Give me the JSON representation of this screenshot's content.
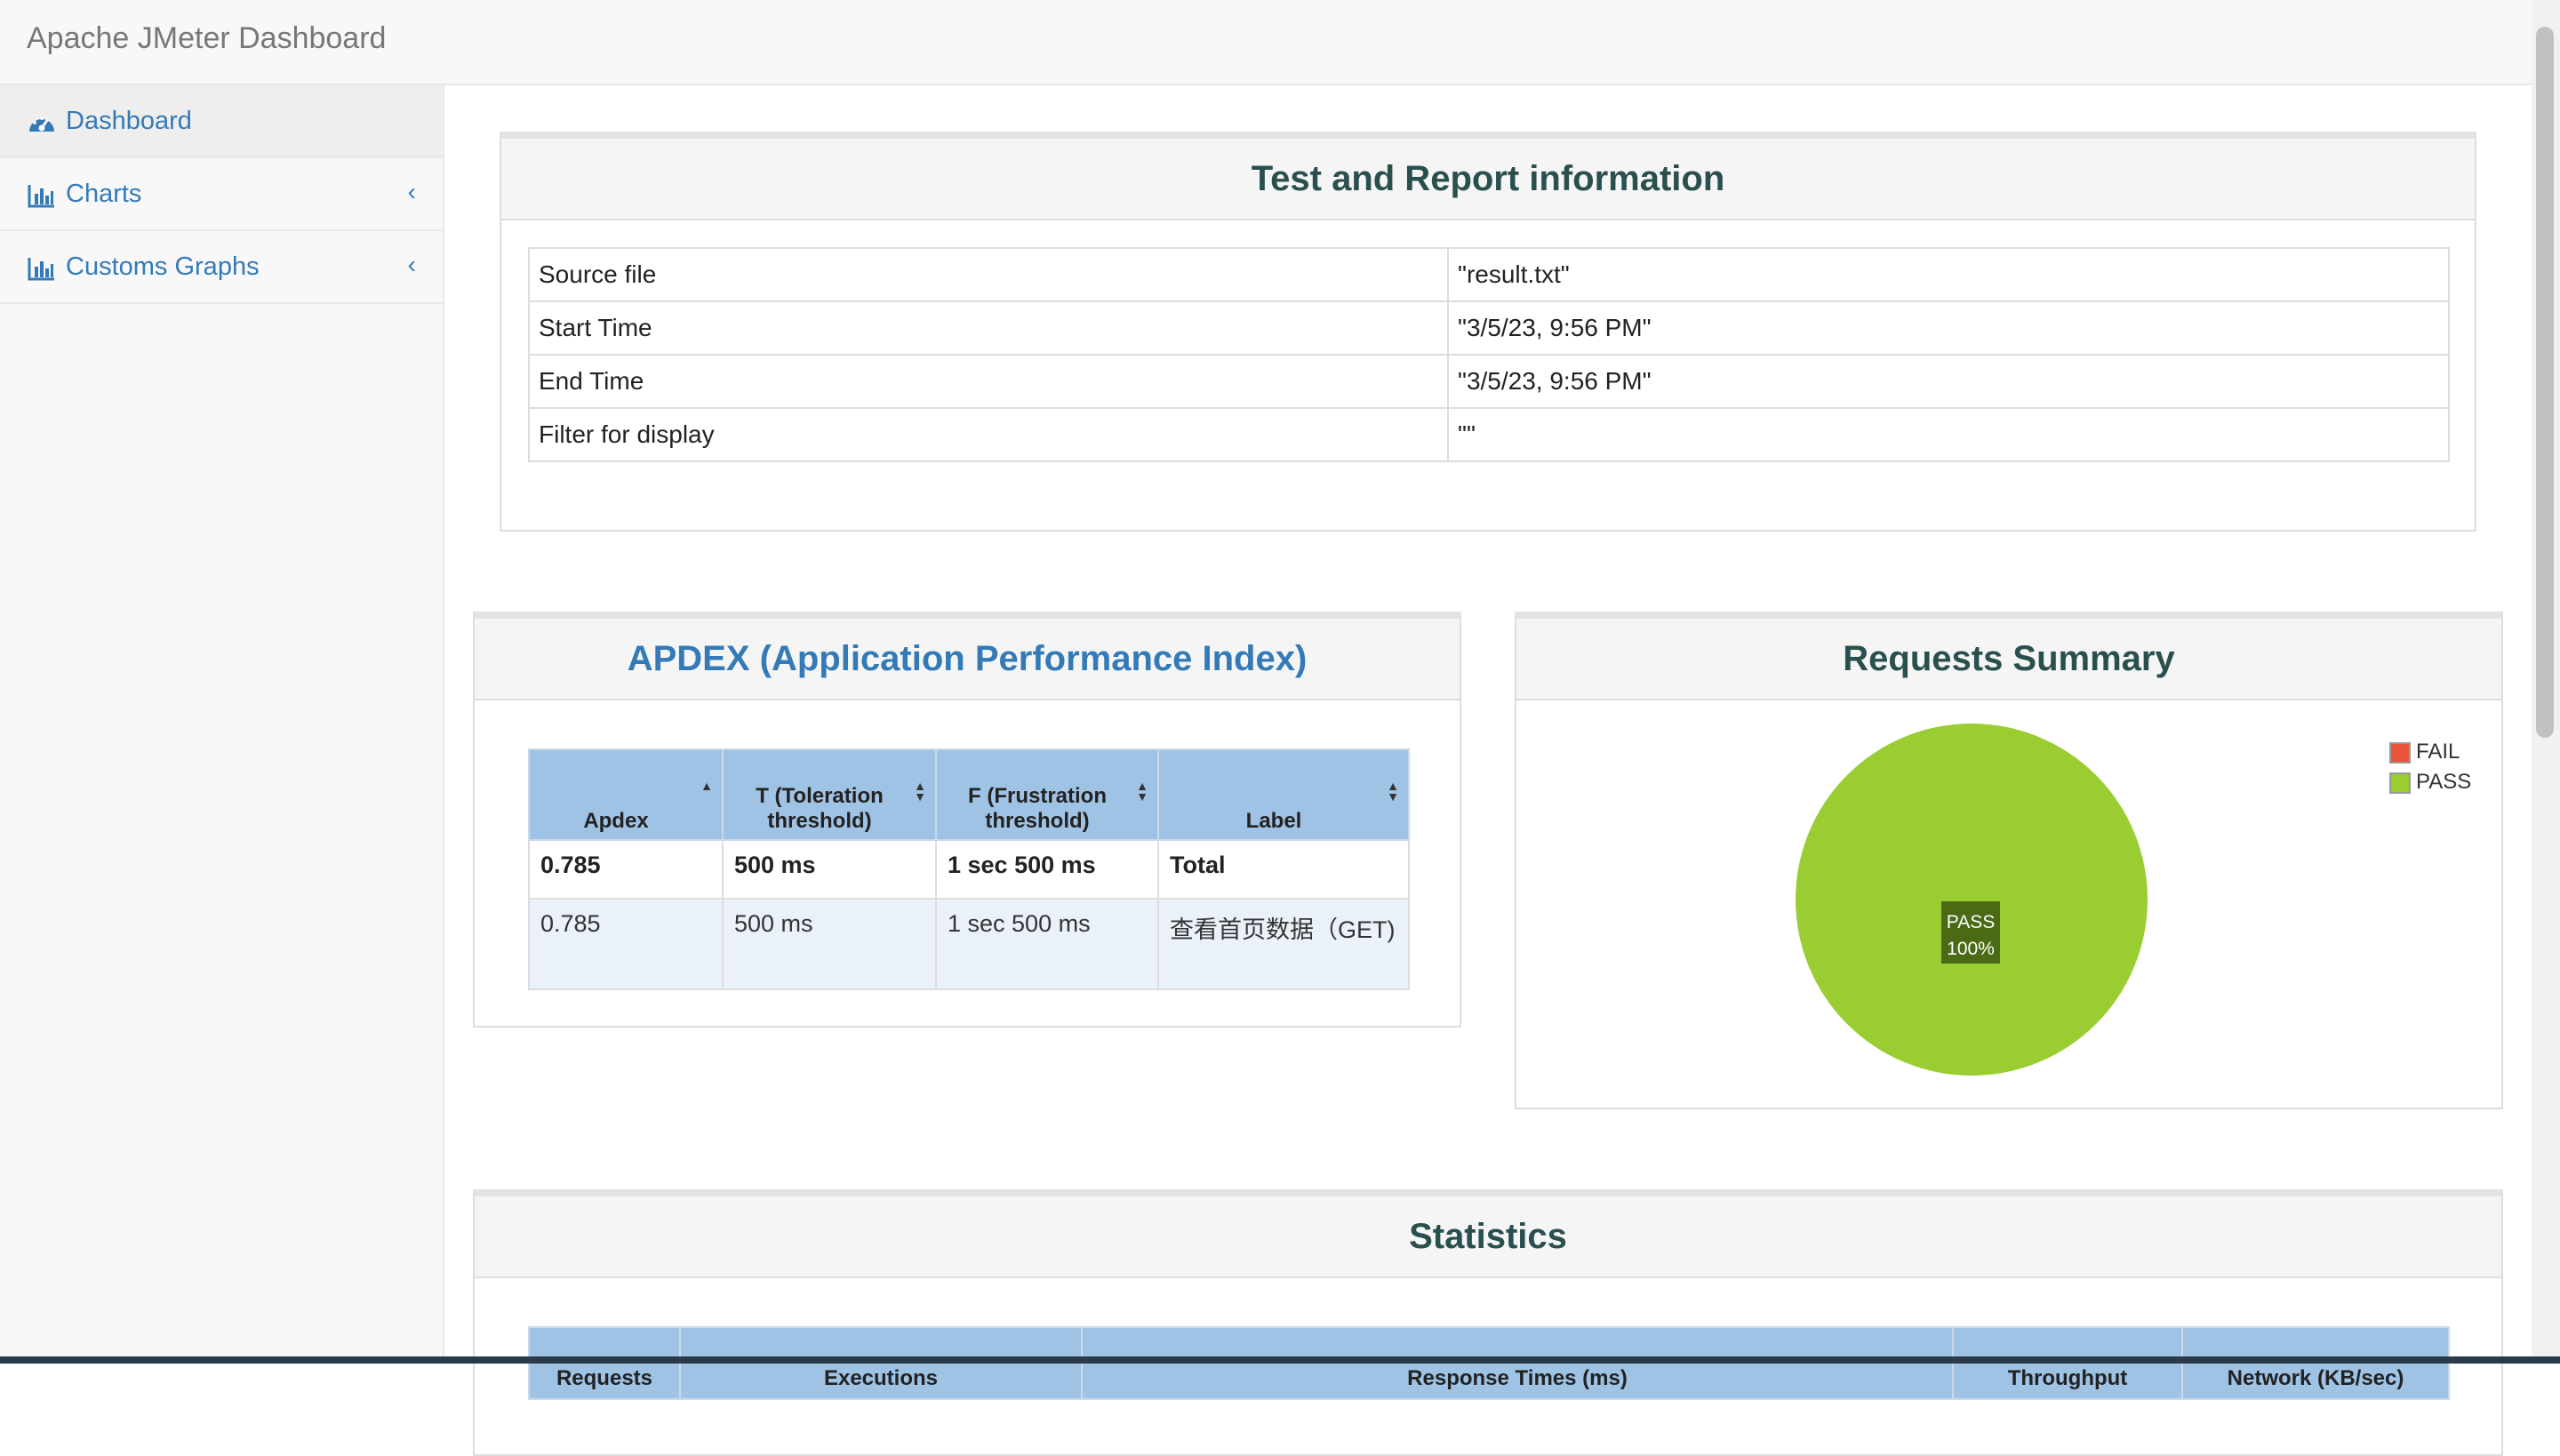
{
  "app": {
    "title": "Apache JMeter Dashboard"
  },
  "sidebar": {
    "items": [
      {
        "label": "Dashboard",
        "icon": "dashboard-icon"
      },
      {
        "label": "Charts",
        "icon": "bar-chart-icon"
      },
      {
        "label": "Customs Graphs",
        "icon": "bar-chart-icon"
      }
    ]
  },
  "report_info": {
    "title": "Test and Report information",
    "rows": [
      {
        "label": "Source file",
        "value": "\"result.txt\""
      },
      {
        "label": "Start Time",
        "value": "\"3/5/23, 9:56 PM\""
      },
      {
        "label": "End Time",
        "value": "\"3/5/23, 9:56 PM\""
      },
      {
        "label": "Filter for display",
        "value": "\"\""
      }
    ]
  },
  "apdex": {
    "title": "APDEX (Application Performance Index)",
    "headers": [
      "Apdex",
      "T (Toleration threshold)",
      "F (Frustration threshold)",
      "Label"
    ],
    "total": [
      "0.785",
      "500 ms",
      "1 sec 500 ms",
      "Total"
    ],
    "rows": [
      [
        "0.785",
        "500 ms",
        "1 sec 500 ms",
        "查看首页数据（GET)"
      ]
    ]
  },
  "requests_summary": {
    "title": "Requests Summary",
    "legend": [
      "FAIL",
      "PASS"
    ],
    "slice_label": "PASS",
    "slice_percent": "100%"
  },
  "statistics": {
    "title": "Statistics",
    "headers": [
      "Requests",
      "Executions",
      "Response Times (ms)",
      "Throughput",
      "Network (KB/sec)"
    ]
  },
  "colors": {
    "pass": "#9acd32",
    "fail": "#e8533b",
    "header_blue": "#9fc3e5",
    "link": "#337ab7"
  },
  "chart_data": {
    "type": "pie",
    "title": "Requests Summary",
    "categories": [
      "FAIL",
      "PASS"
    ],
    "values": [
      0,
      100
    ],
    "legend": "top-right"
  }
}
